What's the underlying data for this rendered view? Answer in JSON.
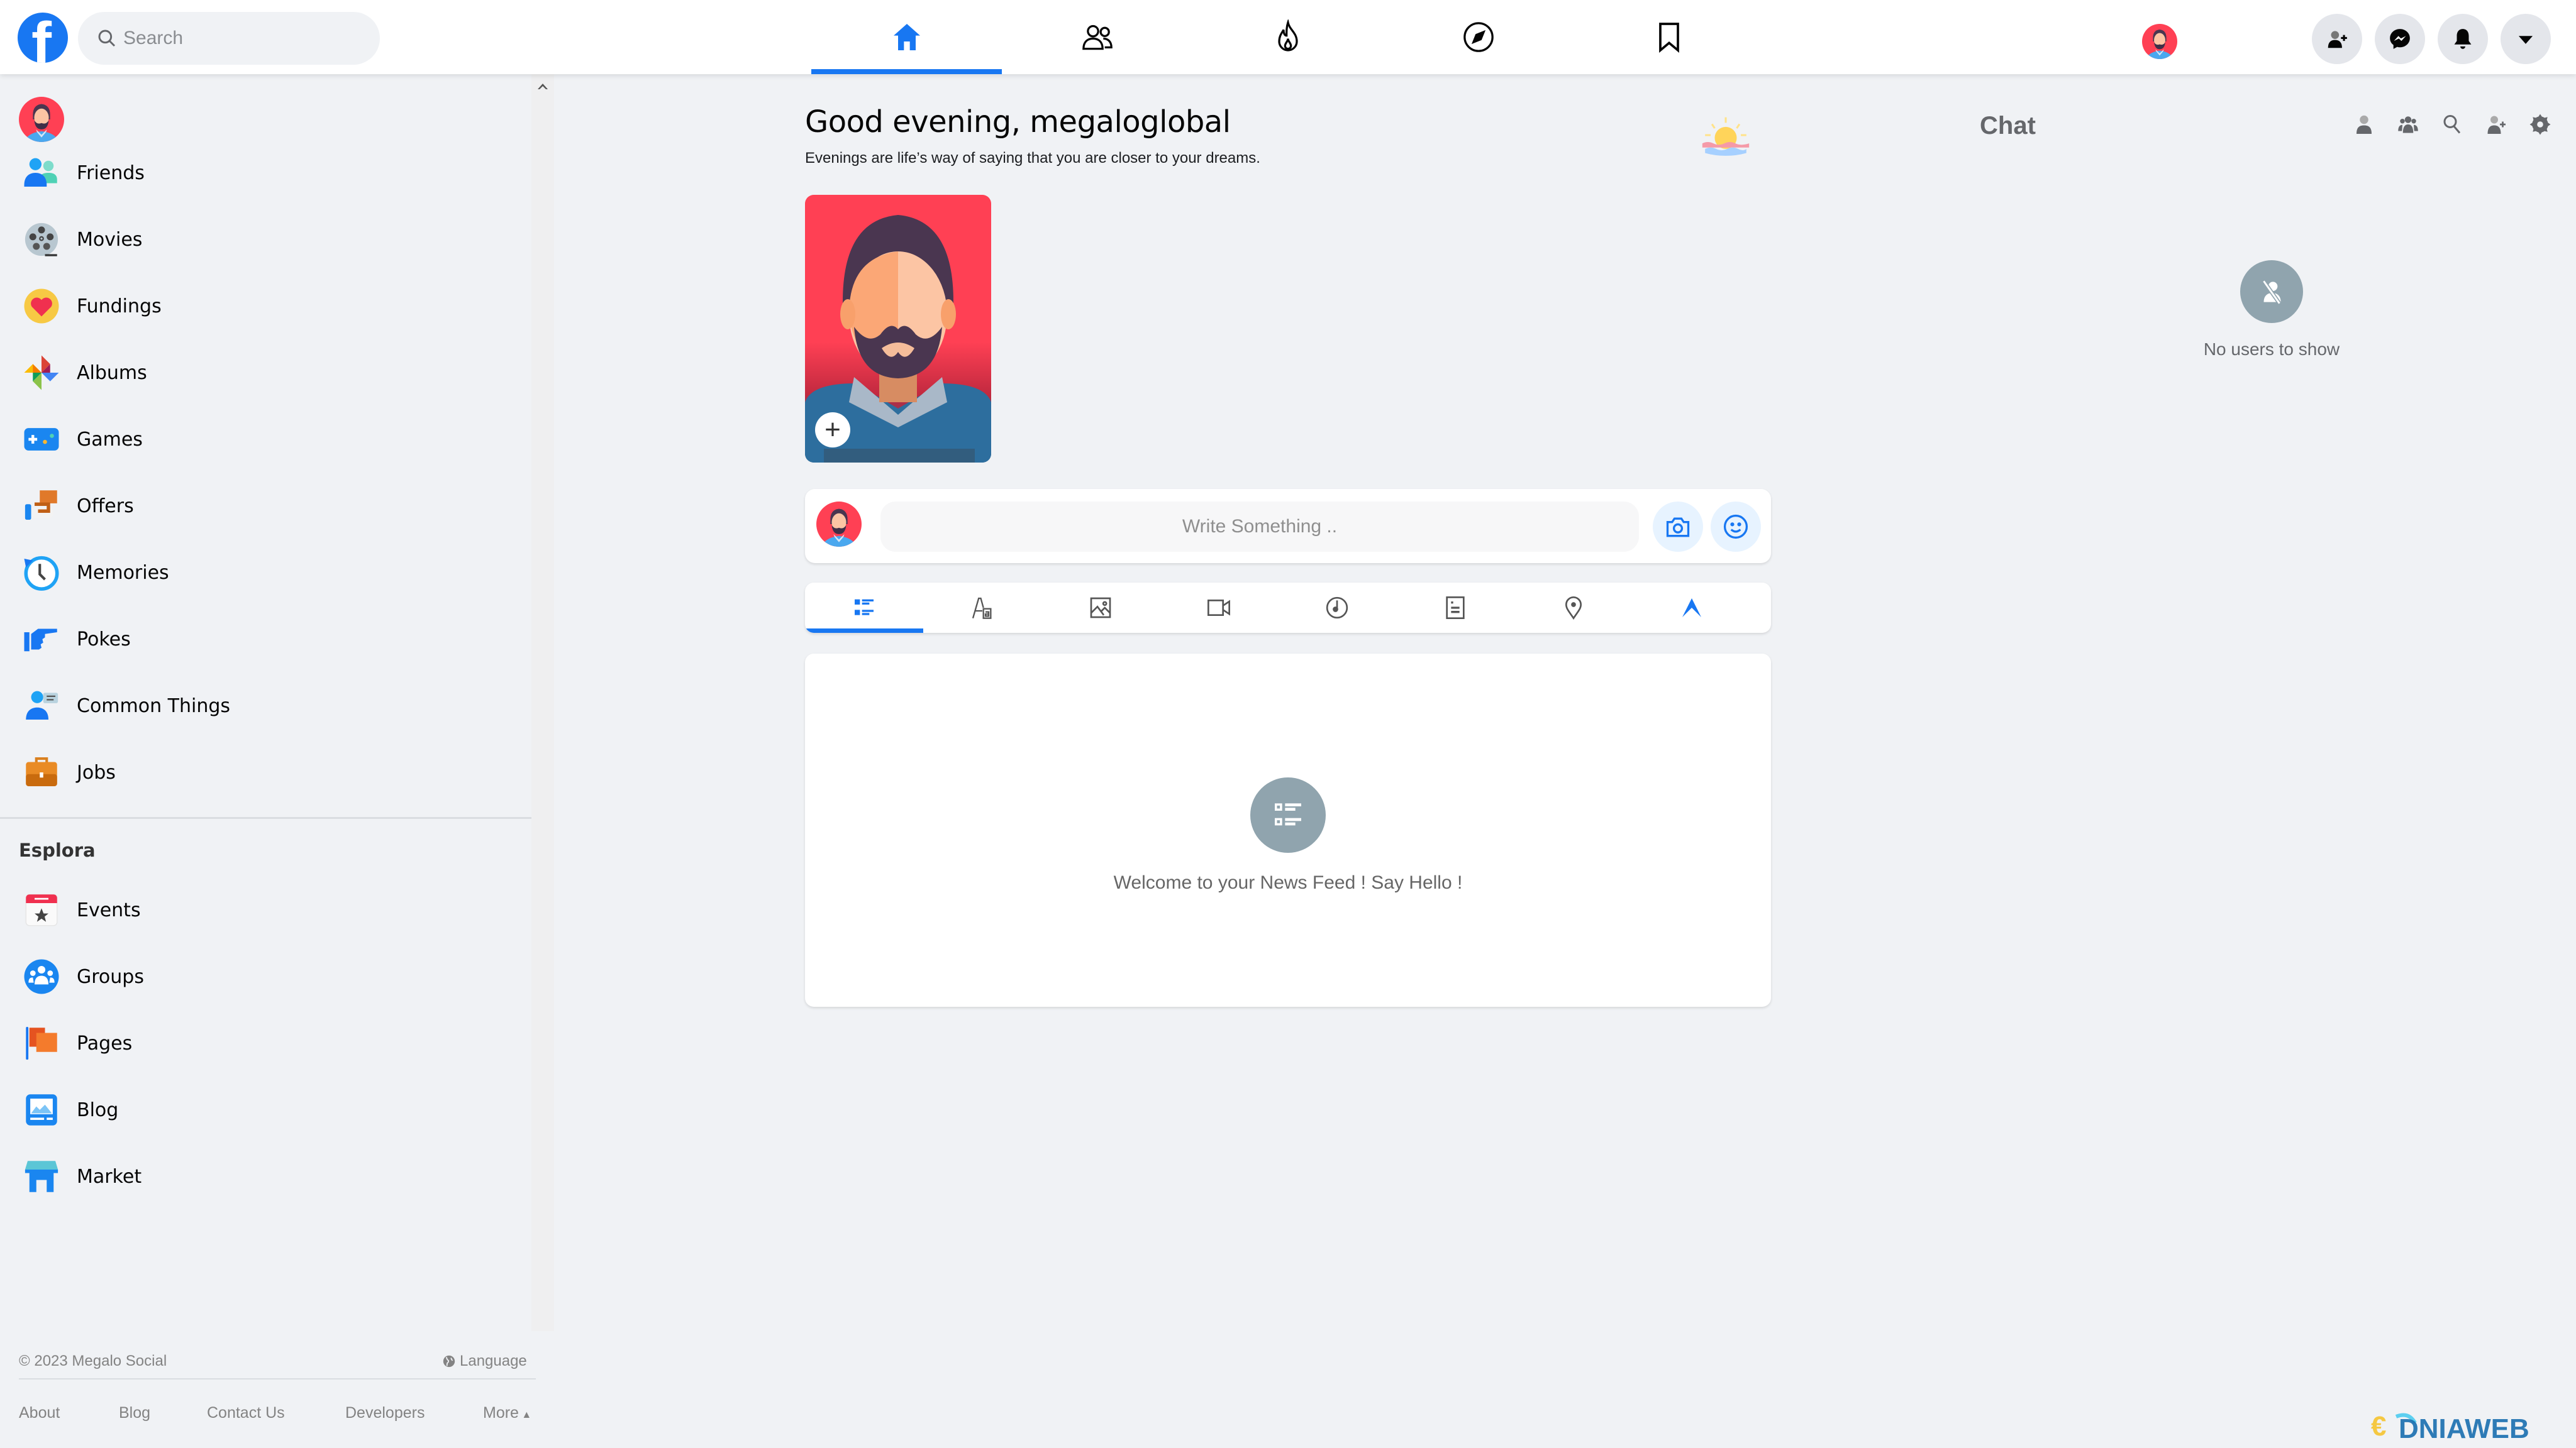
{
  "header": {
    "logo_letter": "f",
    "search_placeholder": "Search",
    "nav_tabs": [
      {
        "name": "home",
        "icon": "home-icon",
        "active": true
      },
      {
        "name": "friends",
        "icon": "friends-icon",
        "active": false
      },
      {
        "name": "trending",
        "icon": "flame-icon",
        "active": false
      },
      {
        "name": "explore",
        "icon": "compass-icon",
        "active": false
      },
      {
        "name": "saved",
        "icon": "bookmark-icon",
        "active": false
      }
    ],
    "right_buttons": [
      "add-friend-icon",
      "messenger-icon",
      "bell-icon",
      "caret-down-icon"
    ]
  },
  "sidebar": {
    "items": [
      {
        "label": "Friends",
        "icon": "friends-icon"
      },
      {
        "label": "Movies",
        "icon": "film-reel-icon"
      },
      {
        "label": "Fundings",
        "icon": "heart-icon"
      },
      {
        "label": "Albums",
        "icon": "pinwheel-icon"
      },
      {
        "label": "Games",
        "icon": "gamepad-icon"
      },
      {
        "label": "Offers",
        "icon": "gift-hand-icon"
      },
      {
        "label": "Memories",
        "icon": "clock-history-icon"
      },
      {
        "label": "Pokes",
        "icon": "pointing-hand-icon"
      },
      {
        "label": "Common Things",
        "icon": "person-chat-icon"
      },
      {
        "label": "Jobs",
        "icon": "briefcase-icon"
      }
    ],
    "section_title": "Esplora",
    "explore_items": [
      {
        "label": "Events",
        "icon": "calendar-star-icon"
      },
      {
        "label": "Groups",
        "icon": "groups-icon"
      },
      {
        "label": "Pages",
        "icon": "flag-icon"
      },
      {
        "label": "Blog",
        "icon": "blog-icon"
      },
      {
        "label": "Market",
        "icon": "storefront-icon"
      }
    ],
    "footer": {
      "copyright": "© 2023 Megalo Social",
      "language": "Language",
      "links": [
        "About",
        "Blog",
        "Contact Us",
        "Developers",
        "More"
      ]
    }
  },
  "main": {
    "greeting": "Good evening, megaloglobal",
    "subtitle": "Evenings are life’s way of saying that you are closer to your dreams.",
    "composer_placeholder": "Write Something ..",
    "feed_tabs": [
      {
        "name": "feed",
        "icon": "list-icon",
        "active": true
      },
      {
        "name": "text",
        "icon": "text-format-icon",
        "active": false
      },
      {
        "name": "photos",
        "icon": "image-icon",
        "active": false
      },
      {
        "name": "videos",
        "icon": "video-icon",
        "active": false
      },
      {
        "name": "music",
        "icon": "music-disc-icon",
        "active": false
      },
      {
        "name": "files",
        "icon": "document-icon",
        "active": false
      },
      {
        "name": "places",
        "icon": "map-pin-icon",
        "active": false
      },
      {
        "name": "top",
        "icon": "chevron-up-icon",
        "active": false
      }
    ],
    "empty_feed_text": "Welcome to your News Feed ! Say Hello !"
  },
  "chat": {
    "title": "Chat",
    "empty_text": "No users to show"
  },
  "colors": {
    "brand": "#1877f2",
    "background": "#f0f2f5",
    "empty_icon_bg": "#90a4ae"
  }
}
